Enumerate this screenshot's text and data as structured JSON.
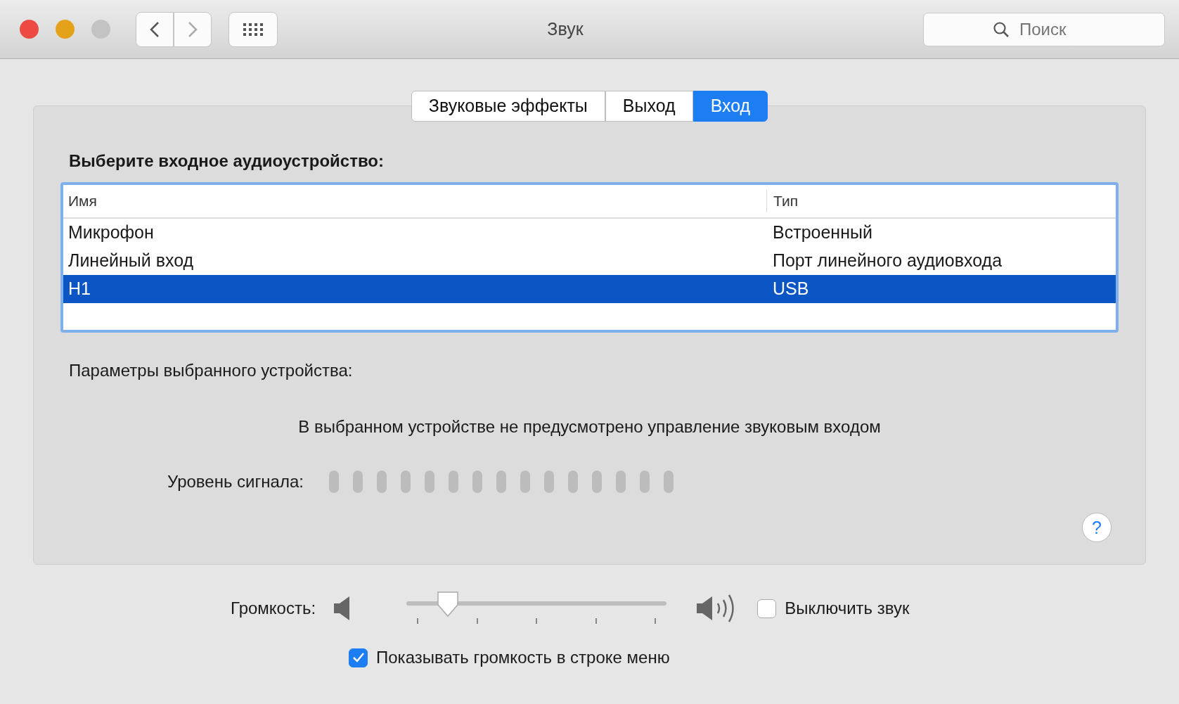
{
  "window": {
    "title": "Звук"
  },
  "search": {
    "placeholder": "Поиск"
  },
  "tabs": [
    {
      "label": "Звуковые эффекты",
      "selected": false
    },
    {
      "label": "Выход",
      "selected": false
    },
    {
      "label": "Вход",
      "selected": true
    }
  ],
  "device_heading": "Выберите входное аудиоустройство:",
  "table": {
    "columns": [
      "Имя",
      "Тип"
    ],
    "rows": [
      {
        "cells": [
          "Микрофон",
          "Встроенный"
        ],
        "selected": false
      },
      {
        "cells": [
          "Линейный вход",
          "Порт линейного аудиовхода"
        ],
        "selected": false
      },
      {
        "cells": [
          "H1",
          "USB"
        ],
        "selected": true
      }
    ]
  },
  "params_heading": "Параметры выбранного устройства:",
  "notice": "В выбранном устройстве не предусмотрено управление звуковым входом",
  "signal": {
    "label": "Уровень сигнала:"
  },
  "help_button": "?",
  "volume": {
    "label": "Громкость:",
    "level": 0.16
  },
  "mute": {
    "label": "Выключить звук",
    "checked": false
  },
  "show_in_menu": {
    "label": "Показывать громкость в строке меню",
    "checked": true
  }
}
